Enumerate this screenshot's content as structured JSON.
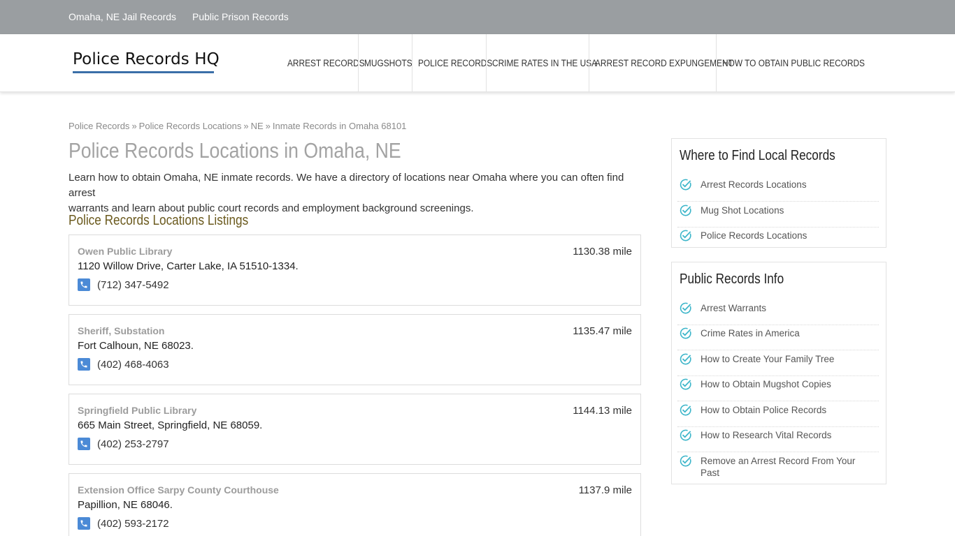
{
  "topbar": {
    "links": [
      "Omaha, NE Jail Records",
      "Public Prison Records"
    ]
  },
  "header": {
    "logo": "Police Records HQ",
    "nav": [
      "ARREST RECORDS",
      "MUGSHOTS",
      "POLICE RECORDS",
      "CRIME RATES IN THE USA",
      "ARREST RECORD EXPUNGEMENT",
      "HOW TO OBTAIN PUBLIC RECORDS"
    ]
  },
  "breadcrumb": [
    "Police Records",
    "Police Records Locations",
    "NE",
    "Inmate Records in Omaha 68101"
  ],
  "breadcrumb_separator": "»",
  "main": {
    "title": "Police Records Locations in Omaha, NE",
    "intro_line1": "Learn how to obtain Omaha, NE inmate records. We have a directory of locations near Omaha where you can often find arrest",
    "intro_line2": "warrants and learn about public court records and employment background screenings.",
    "listings_title": "Police Records Locations Listings",
    "listings": [
      {
        "name": "Owen Public Library",
        "distance": "1130.38 mile",
        "address": "1120 Willow Drive, Carter Lake, IA 51510-1334.",
        "phone": "(712) 347-5492"
      },
      {
        "name": "Sheriff, Substation",
        "distance": "1135.47 mile",
        "address": "Fort Calhoun, NE 68023.",
        "phone": "(402) 468-4063"
      },
      {
        "name": "Springfield Public Library",
        "distance": "1144.13 mile",
        "address": "665 Main Street, Springfield, NE 68059.",
        "phone": "(402) 253-2797"
      },
      {
        "name": "Extension Office Sarpy County Courthouse",
        "distance": "1137.9 mile",
        "address": "Papillion, NE 68046.",
        "phone": "(402) 593-2172"
      }
    ]
  },
  "sidebar": {
    "local": {
      "title": "Where to Find Local Records",
      "items": [
        "Arrest Records Locations",
        "Mug Shot Locations",
        "Police Records Locations"
      ]
    },
    "info": {
      "title": "Public Records Info",
      "items": [
        "Arrest Warrants",
        "Crime Rates in America",
        "How to Create Your Family Tree",
        "How to Obtain Mugshot Copies",
        "How to Obtain Police Records",
        "How to Research Vital Records",
        "Remove an Arrest Record From Your Past"
      ]
    }
  },
  "colors": {
    "topbar": "#9a9ea1",
    "accent_blue": "#3b6fa8",
    "check_teal": "#3bb5c9",
    "phone_icon": "#4b8ad6"
  }
}
